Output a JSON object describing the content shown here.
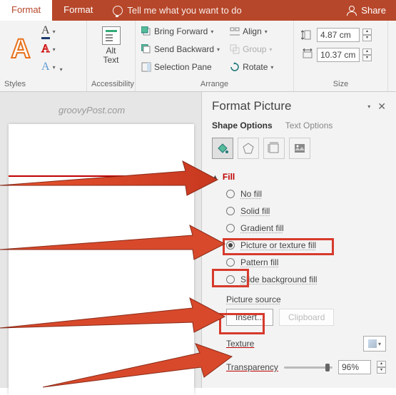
{
  "titlebar": {
    "tab1": "Format",
    "tab2": "Format",
    "tellme": "Tell me what you want to do",
    "share": "Share"
  },
  "ribbon": {
    "styles_label": "Styles",
    "accessibility_label": "Accessibility",
    "arrange_label": "Arrange",
    "size_label": "Size",
    "alt_text": "Alt Text",
    "bring_forward": "Bring Forward",
    "send_backward": "Send Backward",
    "selection_pane": "Selection Pane",
    "align": "Align",
    "group": "Group",
    "rotate": "Rotate",
    "height_value": "4.87 cm",
    "width_value": "10.37 cm"
  },
  "watermark": "groovyPost.com",
  "pane": {
    "title": "Format Picture",
    "tab_shape": "Shape Options",
    "tab_text": "Text Options",
    "fill_header": "Fill",
    "no_fill": "No fill",
    "solid_fill": "Solid fill",
    "gradient_fill": "Gradient fill",
    "picture_fill": "Picture or texture fill",
    "pattern_fill": "Pattern fill",
    "slide_bg_fill": "Slide background fill",
    "picture_source": "Picture source",
    "insert": "Insert...",
    "clipboard": "Clipboard",
    "texture": "Texture",
    "transparency": "Transparency",
    "transparency_value": "96%"
  }
}
